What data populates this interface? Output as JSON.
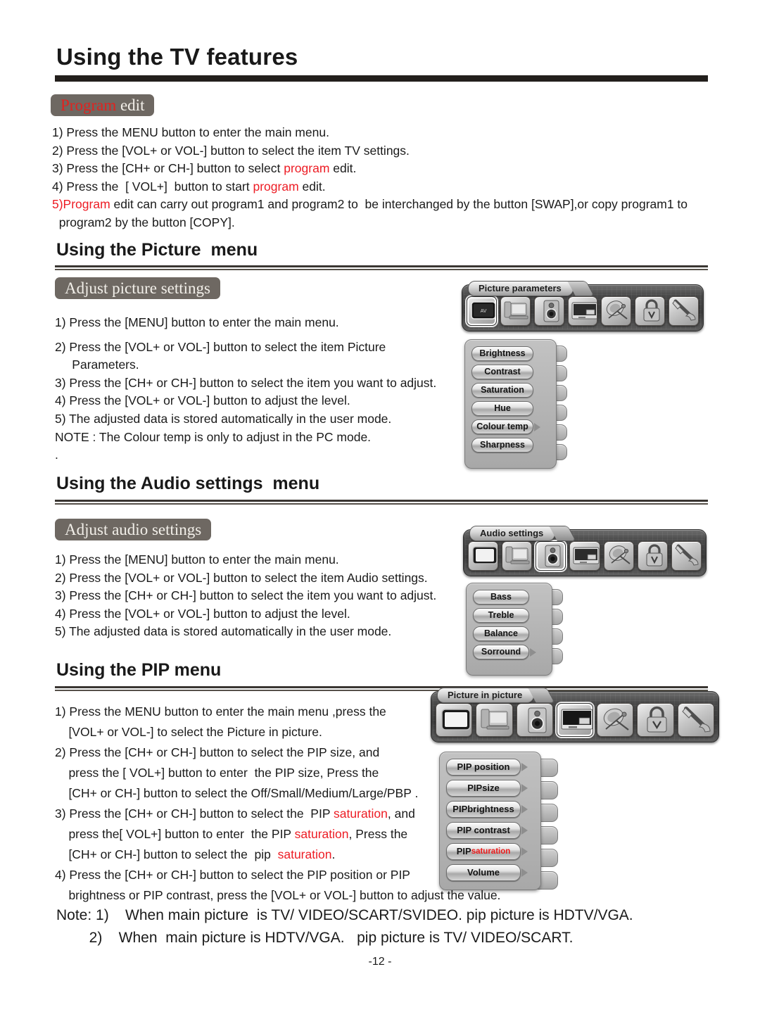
{
  "page": {
    "title": "Using the TV features",
    "page_number": "-12 -"
  },
  "program_edit": {
    "badge_red": "Program",
    "badge_rest": " edit",
    "steps": [
      "1) Press the MENU button to enter the main menu.",
      "2) Press the [VOL+ or VOL-] button to select the item TV settings."
    ],
    "step3_pre": "3) Press the [CH+ or CH-] button to select ",
    "step3_red": "program",
    "step3_post": " edit.",
    "step4_pre": "4) Press the  [ VOL+]  button to start ",
    "step4_red": "program",
    "step4_post": " edit.",
    "step5_red": "5)Program",
    "step5_post": " edit can carry out program1 and program2 to  be interchanged by the button [SWAP],or copy program1 to",
    "step5_line2": "  program2 by the button [COPY]."
  },
  "picture": {
    "heading": "Using the Picture  menu",
    "badge": "Adjust picture settings",
    "steps": [
      "1) Press the [MENU] button to enter the main menu.",
      "2) Press the [VOL+ or VOL-] button to select the item Picture",
      "     Parameters.",
      "3) Press the [CH+ or CH-] button to select the item you want to adjust.",
      "4) Press the [VOL+ or VOL-] button to adjust the level.",
      "5) The adjusted data is stored automatically in the user mode.",
      "NOTE : The Colour temp is only to adjust in the PC mode.",
      "."
    ],
    "osd": {
      "title": "Picture parameters",
      "icons": [
        {
          "name": "tv-screen-icon",
          "selected": true
        },
        {
          "name": "pc-monitor-icon",
          "selected": false
        },
        {
          "name": "speaker-icon",
          "selected": false
        },
        {
          "name": "pip-screen-icon",
          "selected": false
        },
        {
          "name": "satellite-dish-icon",
          "selected": false
        },
        {
          "name": "lock-icon",
          "selected": false
        },
        {
          "name": "tool-wrench-icon",
          "selected": false
        }
      ],
      "items": [
        {
          "label": "Brightness",
          "arrow": false
        },
        {
          "label": "Contrast",
          "arrow": false
        },
        {
          "label": "Saturation",
          "arrow": false
        },
        {
          "label": "Hue",
          "arrow": false
        },
        {
          "label": "Colour temp",
          "arrow": true
        },
        {
          "label": "Sharpness",
          "arrow": false
        }
      ]
    }
  },
  "audio": {
    "heading": "Using the Audio settings  menu",
    "badge": "Adjust audio settings",
    "steps": [
      "1) Press the [MENU] button to enter the main menu.",
      "2) Press the [VOL+ or VOL-] button to select the item Audio settings.",
      "3) Press the [CH+ or CH-] button to select the item you want to adjust.",
      "4) Press the [VOL+ or VOL-] button to adjust the level.",
      "5) The adjusted data is stored automatically in the user mode."
    ],
    "osd": {
      "title": "Audio settings",
      "icons": [
        {
          "name": "tv-screen-icon",
          "selected": false
        },
        {
          "name": "pc-monitor-icon",
          "selected": false
        },
        {
          "name": "speaker-icon",
          "selected": true
        },
        {
          "name": "pip-screen-icon",
          "selected": false
        },
        {
          "name": "satellite-dish-icon",
          "selected": false
        },
        {
          "name": "lock-icon",
          "selected": false
        },
        {
          "name": "tool-wrench-icon",
          "selected": false
        }
      ],
      "items": [
        {
          "label": "Bass",
          "arrow": false
        },
        {
          "label": "Treble",
          "arrow": false
        },
        {
          "label": "Balance",
          "arrow": false
        },
        {
          "label": "Sorround",
          "arrow": true
        }
      ]
    }
  },
  "pip": {
    "heading": "Using the PIP menu",
    "steps_plain": [
      "1) Press the MENU button to enter the main menu ,press the",
      "    [VOL+ or VOL-] to select the Picture in picture.",
      "2) Press the [CH+ or CH-] button to select the PIP size, and",
      "    press the [ VOL+] button to enter  the PIP size, Press the",
      "    [CH+ or CH-] button to select the Off/Small/Medium/Large/PBP ."
    ],
    "step3_a_pre": "3) Press the [CH+ or CH-] button to select the  PIP ",
    "step3_a_red": "saturation",
    "step3_a_post": ", and",
    "step3_b_pre": "    press the[ VOL+] button to enter  the PIP ",
    "step3_b_red": "saturation",
    "step3_b_post": ", Press the",
    "step3_c_pre": "    [CH+ or CH-] button to select the  pip  ",
    "step3_c_red": "saturation",
    "step3_c_post": ".",
    "step4_line1": "4) Press the [CH+ or CH-] button to select the PIP position or PIP",
    "step4_line2": "    brightness or PIP contrast, press the [VOL+ or VOL-] button to adjust the value.",
    "osd": {
      "title": "Picture in picture",
      "icons": [
        {
          "name": "tv-screen-icon",
          "selected": false
        },
        {
          "name": "pc-monitor-icon",
          "selected": false
        },
        {
          "name": "speaker-icon",
          "selected": false
        },
        {
          "name": "pip-screen-icon",
          "selected": true
        },
        {
          "name": "satellite-dish-icon",
          "selected": false
        },
        {
          "name": "lock-icon",
          "selected": false
        },
        {
          "name": "tool-wrench-icon",
          "selected": false
        }
      ],
      "items": [
        {
          "label": "PIP position",
          "arrow": true,
          "red_part": ""
        },
        {
          "label": "PIPsize",
          "arrow": true,
          "red_part": ""
        },
        {
          "label": "PIPbrightness",
          "arrow": true,
          "red_part": ""
        },
        {
          "label": "PIP contrast",
          "arrow": true,
          "red_part": ""
        },
        {
          "label": "PIP ",
          "arrow": true,
          "red_part": "saturation"
        },
        {
          "label": "Volume",
          "arrow": true,
          "red_part": ""
        }
      ]
    }
  },
  "notes": {
    "line1": "Note: 1)    When main picture  is TV/ VIDEO/SCART/SVIDEO. pip picture is HDTV/VGA.",
    "line2": "        2)    When  main picture is HDTV/VGA.   pip picture is TV/ VIDEO/SCART."
  },
  "colors": {
    "red": "#ed1c24",
    "badge_bg": "#6e6862",
    "rule": "#231f1c"
  }
}
